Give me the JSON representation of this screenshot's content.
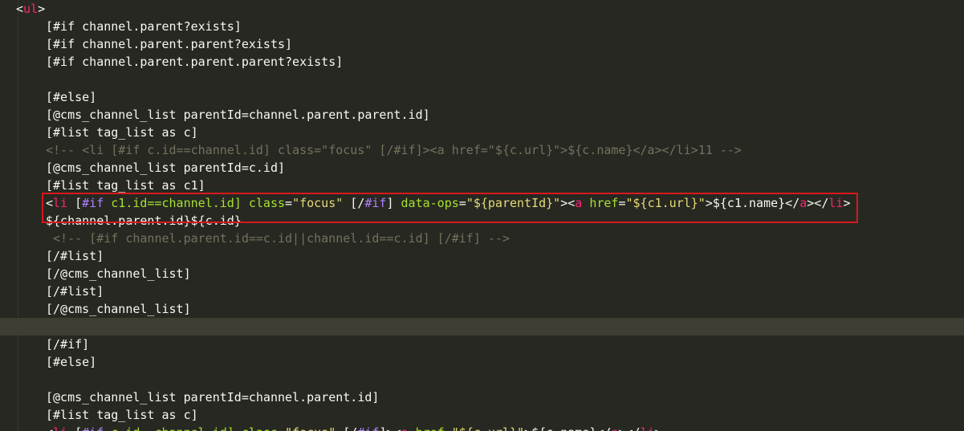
{
  "code_lines": [
    {
      "indent": 0,
      "tokens": [
        {
          "t": "<",
          "c": "plain"
        },
        {
          "t": "ul",
          "c": "tag"
        },
        {
          "t": ">",
          "c": "plain"
        }
      ]
    },
    {
      "indent": 1,
      "tokens": [
        {
          "t": "[#if channel.parent?exists]",
          "c": "plain"
        }
      ]
    },
    {
      "indent": 1,
      "tokens": [
        {
          "t": "[#if channel.parent.parent?exists]",
          "c": "plain"
        }
      ]
    },
    {
      "indent": 1,
      "tokens": [
        {
          "t": "[#if channel.parent.parent.parent?exists]",
          "c": "plain"
        }
      ]
    },
    {
      "indent": 1,
      "tokens": []
    },
    {
      "indent": 1,
      "tokens": [
        {
          "t": "[#else]",
          "c": "plain"
        }
      ]
    },
    {
      "indent": 1,
      "tokens": [
        {
          "t": "[@cms_channel_list parentId=channel.parent.parent.id]",
          "c": "plain"
        }
      ]
    },
    {
      "indent": 1,
      "tokens": [
        {
          "t": "[#list tag_list as c]",
          "c": "plain"
        }
      ]
    },
    {
      "indent": 1,
      "tokens": [
        {
          "t": "<!-- <li [#if c.id==channel.id] class=\"focus\" [/#if]><a href=\"${c.url}\">${c.name}</a></li>11 -->",
          "c": "comment"
        }
      ]
    },
    {
      "indent": 1,
      "tokens": [
        {
          "t": "[@cms_channel_list parentId=c.id]",
          "c": "plain"
        }
      ]
    },
    {
      "indent": 1,
      "tokens": [
        {
          "t": "[#list tag_list as c1]",
          "c": "plain"
        }
      ]
    },
    {
      "indent": 1,
      "tokens": [
        {
          "t": "<",
          "c": "plain"
        },
        {
          "t": "li",
          "c": "tag"
        },
        {
          "t": " [",
          "c": "plain"
        },
        {
          "t": "#if",
          "c": "kw"
        },
        {
          "t": " c1.id==channel.id] ",
          "c": "attr"
        },
        {
          "t": "class",
          "c": "attr"
        },
        {
          "t": "=",
          "c": "plain"
        },
        {
          "t": "\"focus\"",
          "c": "str"
        },
        {
          "t": " [/",
          "c": "plain"
        },
        {
          "t": "#if",
          "c": "kw"
        },
        {
          "t": "] ",
          "c": "plain"
        },
        {
          "t": "data-ops",
          "c": "attr"
        },
        {
          "t": "=",
          "c": "plain"
        },
        {
          "t": "\"${parentId}\"",
          "c": "str"
        },
        {
          "t": "><",
          "c": "plain"
        },
        {
          "t": "a",
          "c": "tag"
        },
        {
          "t": " ",
          "c": "plain"
        },
        {
          "t": "href",
          "c": "attr"
        },
        {
          "t": "=",
          "c": "plain"
        },
        {
          "t": "\"${c1.url}\"",
          "c": "str"
        },
        {
          "t": ">${c1.name}</",
          "c": "plain"
        },
        {
          "t": "a",
          "c": "tag"
        },
        {
          "t": "></",
          "c": "plain"
        },
        {
          "t": "li",
          "c": "tag"
        },
        {
          "t": ">",
          "c": "plain"
        }
      ]
    },
    {
      "indent": 1,
      "tokens": [
        {
          "t": "${channel.parent.id}${c.id}",
          "c": "plain"
        }
      ]
    },
    {
      "indent": 1,
      "tokens": [
        {
          "t": " <!-- [#if channel.parent.id==c.id||channel.id==c.id] [/#if] -->",
          "c": "comment"
        }
      ]
    },
    {
      "indent": 1,
      "tokens": [
        {
          "t": "[/#list]",
          "c": "plain"
        }
      ]
    },
    {
      "indent": 1,
      "tokens": [
        {
          "t": "[/@cms_channel_list]",
          "c": "plain"
        }
      ]
    },
    {
      "indent": 1,
      "tokens": [
        {
          "t": "[/#list]",
          "c": "plain"
        }
      ]
    },
    {
      "indent": 1,
      "tokens": [
        {
          "t": "[/@cms_channel_list]",
          "c": "plain"
        }
      ]
    },
    {
      "indent": 1,
      "tokens": [],
      "current": true
    },
    {
      "indent": 1,
      "tokens": [
        {
          "t": "[/#if]",
          "c": "plain"
        }
      ]
    },
    {
      "indent": 1,
      "tokens": [
        {
          "t": "[#else]",
          "c": "plain"
        }
      ]
    },
    {
      "indent": 1,
      "tokens": []
    },
    {
      "indent": 1,
      "tokens": [
        {
          "t": "[@cms_channel_list parentId=channel.parent.id]",
          "c": "plain"
        }
      ]
    },
    {
      "indent": 1,
      "tokens": [
        {
          "t": "[#list tag_list as c]",
          "c": "plain"
        }
      ]
    },
    {
      "indent": 1,
      "tokens": [
        {
          "t": "<",
          "c": "plain"
        },
        {
          "t": "li",
          "c": "tag"
        },
        {
          "t": " [",
          "c": "plain"
        },
        {
          "t": "#if",
          "c": "kw"
        },
        {
          "t": " c.id==channel.id] ",
          "c": "attr"
        },
        {
          "t": "class",
          "c": "attr"
        },
        {
          "t": "=",
          "c": "plain"
        },
        {
          "t": "\"focus\"",
          "c": "str"
        },
        {
          "t": " [/",
          "c": "plain"
        },
        {
          "t": "#if",
          "c": "kw"
        },
        {
          "t": "]><",
          "c": "plain"
        },
        {
          "t": "a",
          "c": "tag"
        },
        {
          "t": " ",
          "c": "plain"
        },
        {
          "t": "href",
          "c": "attr"
        },
        {
          "t": "=",
          "c": "plain"
        },
        {
          "t": "\"${c.url}\"",
          "c": "str"
        },
        {
          "t": ">${c.name}</",
          "c": "plain"
        },
        {
          "t": "a",
          "c": "tag"
        },
        {
          "t": "></",
          "c": "plain"
        },
        {
          "t": "li",
          "c": "tag"
        },
        {
          "t": ">",
          "c": "plain"
        }
      ]
    }
  ],
  "colors": {
    "background": "#272822",
    "current_line": "#3e3d32",
    "plain": "#f8f8f2",
    "tag": "#f92672",
    "attr": "#a6e22e",
    "string": "#e6db74",
    "keyword": "#ae81ff",
    "comment": "#75715e",
    "highlight_box": "#d7191c"
  }
}
